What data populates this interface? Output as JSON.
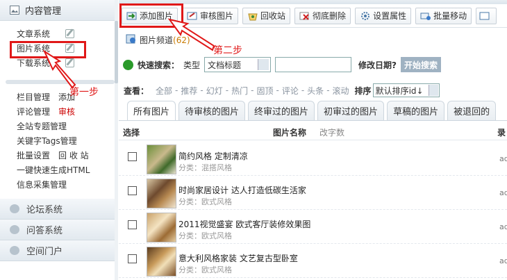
{
  "sidebar": {
    "section_content": "内容管理",
    "sub_items": [
      {
        "label": "文章系统"
      },
      {
        "label": "图片系统"
      },
      {
        "label": "下载系统"
      }
    ],
    "menu_rows": [
      {
        "label": "栏目管理",
        "extra": "添加",
        "extra_red": false
      },
      {
        "label": "评论管理",
        "extra": "审核",
        "extra_red": true
      },
      {
        "label": "全站专题管理",
        "extra": "",
        "extra_red": false
      },
      {
        "label": "关键字Tags管理",
        "extra": "",
        "extra_red": false
      },
      {
        "label": "批量设置",
        "extra": "回 收 站",
        "extra_red": false
      },
      {
        "label": "一键快速生成HTML",
        "extra": "",
        "extra_red": false
      },
      {
        "label": "信息采集管理",
        "extra": "",
        "extra_red": false
      }
    ],
    "collapsed_sections": [
      {
        "label": "论坛系统"
      },
      {
        "label": "问答系统"
      },
      {
        "label": "空间门户"
      }
    ]
  },
  "toolbar": {
    "buttons": [
      {
        "label": "添加图片",
        "icon": "add-image-icon"
      },
      {
        "label": "审核图片",
        "icon": "audit-icon"
      },
      {
        "label": "回收站",
        "icon": "recycle-icon"
      },
      {
        "label": "彻底删除",
        "icon": "delete-icon"
      },
      {
        "label": "设置属性",
        "icon": "gear-icon"
      },
      {
        "label": "批量移动",
        "icon": "move-icon"
      }
    ]
  },
  "channel": {
    "label": "图片频道",
    "count": "(62)"
  },
  "annotations": {
    "step1": "第一步",
    "step2": "第二步"
  },
  "search": {
    "label": "快速搜索：",
    "type_label": "类型",
    "type_value": "文档标题",
    "query": "",
    "date_label": "修改日期?",
    "button": "开始搜索"
  },
  "filters": {
    "label": "查看：",
    "items": [
      "全部",
      "推荐",
      "幻灯",
      "热门",
      "固顶",
      "评论",
      "头条",
      "滚动"
    ],
    "sort_label": "排序",
    "sort_value": "默认排序id↓"
  },
  "tabs": [
    "所有图片",
    "待审核的图片",
    "终审过的图片",
    "初审过的图片",
    "草稿的图片",
    "被退回的"
  ],
  "table": {
    "col_select": "选择",
    "col_name": "图片名称",
    "col_name_sort": "改字数",
    "col_right": "录",
    "cat_prefix": "分类：",
    "rows": [
      {
        "title": "简约风格 定制清凉",
        "category": "混搭风格",
        "right": "ad"
      },
      {
        "title": "时尚家居设计 达人打造低碳生活家",
        "category": "欧式风格",
        "right": "ad"
      },
      {
        "title": "2011视觉盛宴 欧式客厅装修效果图",
        "category": "欧式风格",
        "right": "ad"
      },
      {
        "title": "意大利风格家装 文艺复古型卧室",
        "category": "欧式风格",
        "right": "ad"
      }
    ]
  },
  "colors": {
    "accent_red": "#e01818",
    "link_gray": "#8a94a0",
    "button_gray": "#9fb2c2"
  }
}
